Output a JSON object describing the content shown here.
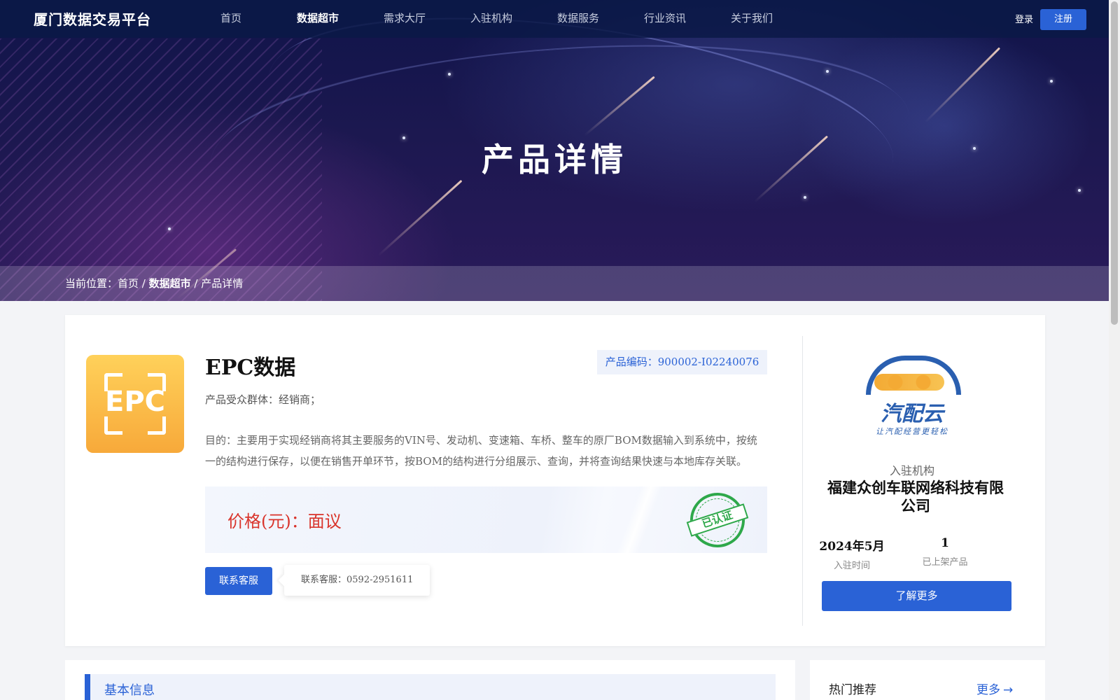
{
  "header": {
    "logo": "厦门数据交易平台",
    "nav": [
      "首页",
      "数据超市",
      "需求大厅",
      "入驻机构",
      "数据服务",
      "行业资讯",
      "关于我们"
    ],
    "active_nav": "数据超市",
    "login": "登录",
    "register": "注册"
  },
  "hero": {
    "title": "产品详情"
  },
  "breadcrumb": {
    "prefix": "当前位置：",
    "home": "首页",
    "sep1": " / ",
    "category": "数据超市",
    "sep2": " / ",
    "current": "产品详情"
  },
  "product": {
    "icon_text": "EPC",
    "title": "EPC数据",
    "code": "产品编码：900002-I02240076",
    "audience": "产品受众群体：经销商；",
    "purpose": "目的：主要用于实现经销商将其主要服务的VIN号、发动机、变速箱、车桥、整车的原厂BOM数据输入到系统中，按统一的结构进行保存，以便在销售开单环节，按BOM的结构进行分组展示、查询，并将查询结果快速与本地库存关联。",
    "price": "价格(元)：面议",
    "certified_stamp": "已认证",
    "contact_button": "联系客服",
    "contact_popup": "联系客服：0592-2951611"
  },
  "organization": {
    "logo_brand": "汽配云",
    "logo_slogan": "让汽配经营更轻松",
    "caption": "入驻机构",
    "name": "福建众创车联网络科技有限公司",
    "join_date": "2024年5月",
    "join_date_label": "入驻时间",
    "products_count": "1",
    "products_label": "已上架产品",
    "learn_more": "了解更多"
  },
  "sections": {
    "basic_info": "基本信息",
    "hot_title": "热门推荐",
    "hot_more": "更多"
  },
  "colors": {
    "primary": "#2a62d6",
    "price_red": "#d9342b",
    "stamp_green": "#2ea84a"
  }
}
